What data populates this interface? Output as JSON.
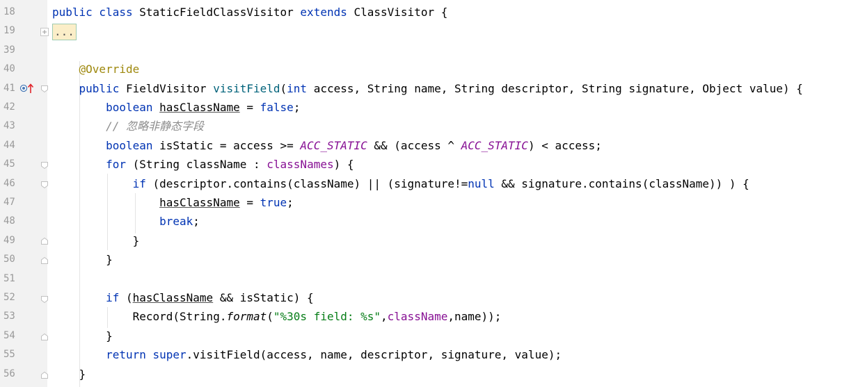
{
  "editor": {
    "line_numbers": [
      "18",
      "19",
      "39",
      "40",
      "41",
      "42",
      "43",
      "44",
      "45",
      "46",
      "47",
      "48",
      "49",
      "50",
      "51",
      "52",
      "53",
      "54",
      "55",
      "56"
    ],
    "collapsed_placeholder": "...",
    "comment_text": "// 忽略非静态字段",
    "icons": {
      "override_marker": "override-up-arrow-icon",
      "fold_marker": "fold-marker-icon",
      "expand": "fold-plus-icon"
    },
    "colors": {
      "keyword": "#0033b3",
      "annotation": "#9e880d",
      "comment": "#8c8c8c",
      "constant": "#871094",
      "string": "#067d17",
      "method": "#00627a"
    }
  }
}
